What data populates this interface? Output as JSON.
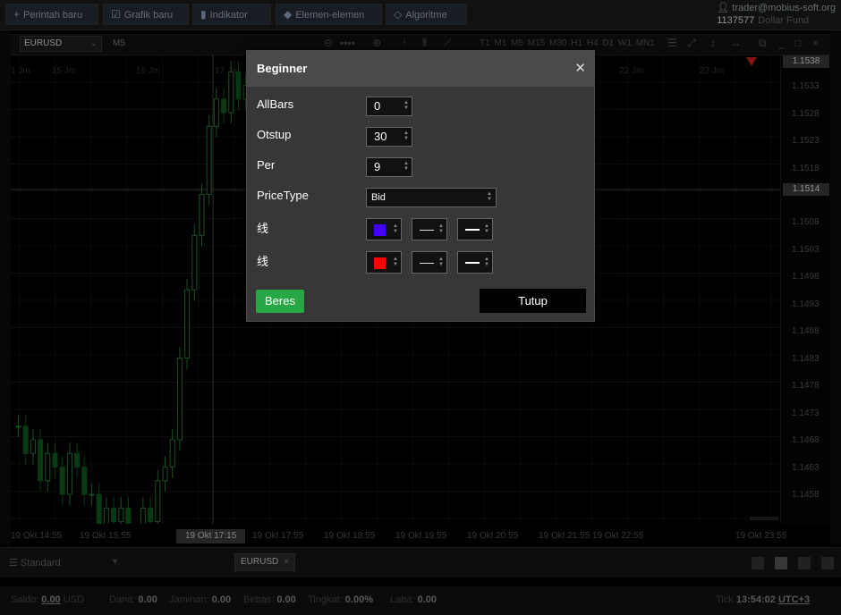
{
  "toolbar": {
    "new_order": "Perintah baru",
    "new_chart": "Grafik baru",
    "indicator": "Indikator",
    "elements": "Elemen-elemen",
    "algorithm": "Algoritme",
    "icons": {
      "new_order": "plus-icon",
      "new_chart": "chart-icon",
      "indicator": "bar-chart-icon",
      "elements": "shapes-icon",
      "algorithm": "diamond-icon"
    }
  },
  "account": {
    "email": "trader@mobius-soft.org",
    "number": "1137577",
    "fund": "Dollar Fund"
  },
  "chart": {
    "symbol": "EURUSD",
    "timeframe": "M5",
    "timeframes": "T1 M1 M5 M15 M30 H1 H4 D1 W1 MN1",
    "top_times": [
      "1 Jm",
      "15 Jm",
      "16 Jm",
      "17 Jm",
      "22 Jm",
      "23 Jm"
    ],
    "y_labels": [
      "1.1533",
      "1.1528",
      "1.1523",
      "1.1518",
      "1.1508",
      "1.1503",
      "1.1498",
      "1.1493",
      "1.1488",
      "1.1483",
      "1.1478",
      "1.1473",
      "1.1468",
      "1.1463",
      "1.1458"
    ],
    "y_badge_top": "1.1538",
    "y_badge_cursor": "1.1514",
    "x_labels": [
      "19 Okt 14:55",
      "19 Okt 15:55",
      "19 Okt 17:55",
      "19 Okt 18:55",
      "19 Okt 19:55",
      "19 Okt 20:55",
      "19 Okt 21:55",
      "19 Okt 22:55",
      "19 Okt 23:55"
    ],
    "x_badge_cursor": "19 Okt 17:15",
    "bull_color": "#0f5a20",
    "bear_color": "#2a7a35"
  },
  "dialog": {
    "title": "Beginner",
    "fields": {
      "allbars_label": "AllBars",
      "allbars_value": "0",
      "otstup_label": "Otstup",
      "otstup_value": "30",
      "per_label": "Per",
      "per_value": "9",
      "pricetype_label": "PriceType",
      "pricetype_value": "Bid",
      "line1_label": "线",
      "line1_color": "#4400ff",
      "line2_label": "线",
      "line2_color": "#ff0000"
    },
    "ok_label": "Beres",
    "close_label": "Tutup"
  },
  "bottom": {
    "workspace": "Standard",
    "tab": "EURUSD"
  },
  "status": {
    "saldo_label": "Saldo:",
    "saldo_value": "0.00",
    "saldo_unit": "USD",
    "dana_label": "Dana:",
    "dana_value": "0.00",
    "jaminan_label": "Jaminan:",
    "jaminan_value": "0.00",
    "bebas_label": "Bebas:",
    "bebas_value": "0.00",
    "tingkat_label": "Tingkat:",
    "tingkat_value": "0.00%",
    "laba_label": "Laba:",
    "laba_value": "0.00",
    "tick_label": "Tick",
    "time": "13:54:02",
    "tz": "UTC+3"
  }
}
